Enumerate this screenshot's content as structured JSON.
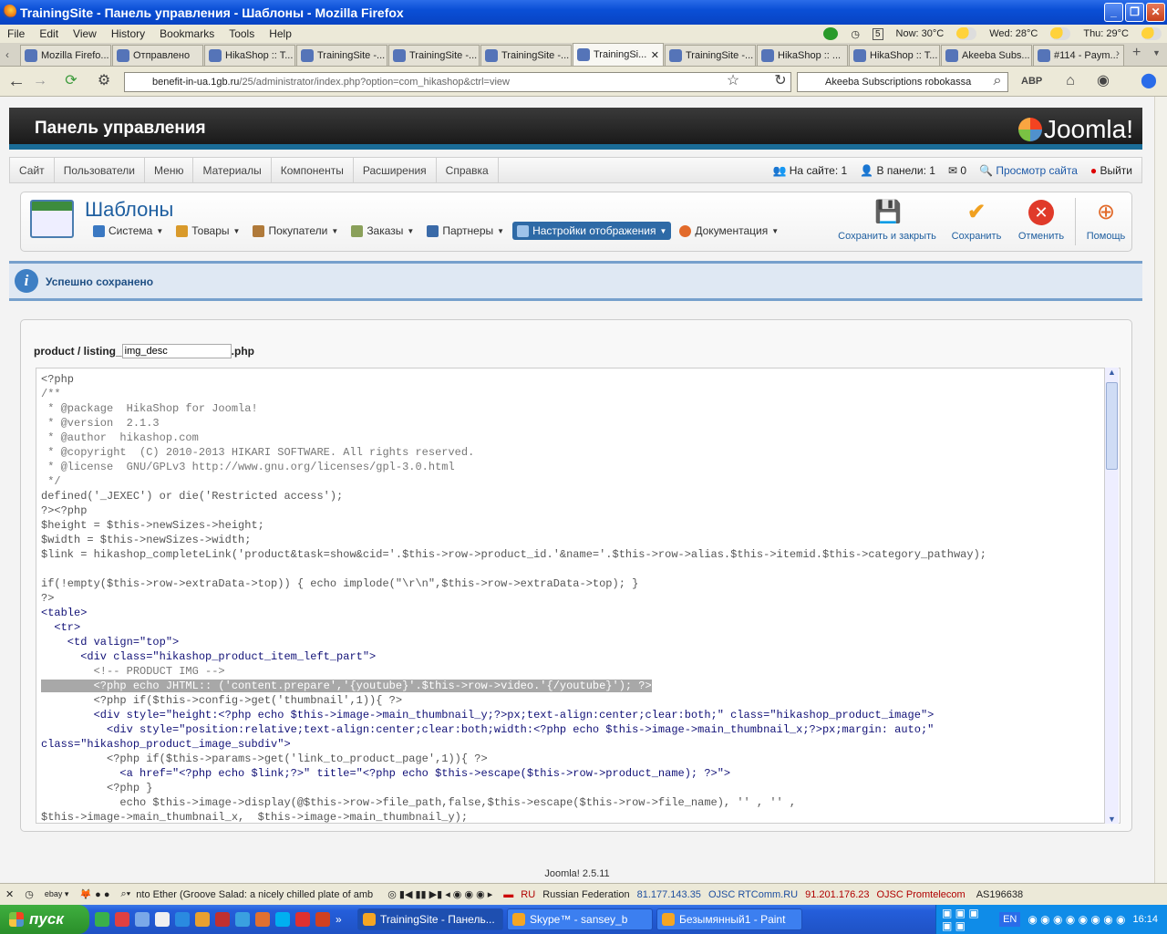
{
  "window": {
    "title": "TrainingSite - Панель управления - Шаблоны - Mozilla Firefox"
  },
  "menu": [
    "File",
    "Edit",
    "View",
    "History",
    "Bookmarks",
    "Tools",
    "Help"
  ],
  "weather": {
    "now": "Now: 30°C",
    "wed": "Wed: 28°C",
    "thu": "Thu: 29°C",
    "badge": "5"
  },
  "tabs": [
    "Mozilla Firefo...",
    "Отправлено",
    "HikaShop :: T...",
    "TrainingSite -...",
    "TrainingSite -...",
    "TrainingSite -...",
    "TrainingSi...",
    "TrainingSite -...",
    "HikaShop :: ...",
    "HikaShop :: T...",
    "Akeeba Subs...",
    "#114 - Paym..."
  ],
  "active_tab_index": 6,
  "address": {
    "host": "benefit-in-ua.1gb.ru",
    "path": "/25/administrator/index.php?option=com_hikashop&ctrl=view"
  },
  "search": {
    "value": "Akeeba Subscriptions robokassa"
  },
  "joomla": {
    "header": "Панель управления",
    "logo": "Joomla!",
    "menu": [
      "Сайт",
      "Пользователи",
      "Меню",
      "Материалы",
      "Компоненты",
      "Расширения",
      "Справка"
    ],
    "status": {
      "on_site": "На сайте: 1",
      "in_panel": "В панели: 1",
      "messages": "0",
      "view_site": "Просмотр сайта",
      "logout": "Выйти"
    },
    "page_title": "Шаблоны",
    "submenu": [
      "Система",
      "Товары",
      "Покупатели",
      "Заказы",
      "Партнеры",
      "Настройки отображения",
      "Документация"
    ],
    "toolbar": {
      "save_close": "Сохранить и закрыть",
      "save": "Сохранить",
      "cancel": "Отменить",
      "help": "Помощь"
    },
    "message": "Успешно сохранено",
    "file": {
      "prefix": "product / listing_",
      "value": "img_desc",
      "suffix": ".php"
    },
    "footer": "Joomla! 2.5.11"
  },
  "code_lines": [
    "<?php",
    "/**",
    " * @package  HikaShop for Joomla!",
    " * @version  2.1.3",
    " * @author  hikashop.com",
    " * @copyright  (C) 2010-2013 HIKARI SOFTWARE. All rights reserved.",
    " * @license  GNU/GPLv3 http://www.gnu.org/licenses/gpl-3.0.html",
    " */",
    "defined('_JEXEC') or die('Restricted access');",
    "?><?php",
    "$height = $this->newSizes->height;",
    "$width = $this->newSizes->width;",
    "$link = hikashop_completeLink('product&task=show&cid='.$this->row->product_id.'&name='.$this->row->alias.$this->itemid.$this->category_pathway);",
    "",
    "if(!empty($this->row->extraData->top)) { echo implode(\"\\r\\n\",$this->row->extraData->top); }",
    "?>",
    "<table>",
    "  <tr>",
    "    <td valign=\"top\">",
    "      <div class=\"hikashop_product_item_left_part\">",
    "        <!-- PRODUCT IMG -->",
    "        <?php echo JHTML:: ('content.prepare','{youtube}'.$this->row->video.'{/youtube}'); ?>",
    "        <?php if($this->config->get('thumbnail',1)){ ?>",
    "        <div style=\"height:<?php echo $this->image->main_thumbnail_y;?>px;text-align:center;clear:both;\" class=\"hikashop_product_image\">",
    "          <div style=\"position:relative;text-align:center;clear:both;width:<?php echo $this->image->main_thumbnail_x;?>px;margin: auto;\"",
    "class=\"hikashop_product_image_subdiv\">",
    "          <?php if($this->params->get('link_to_product_page',1)){ ?>",
    "            <a href=\"<?php echo $link;?>\" title=\"<?php echo $this->escape($this->row->product_name); ?>\">",
    "          <?php }",
    "            echo $this->image->display(@$this->row->file_path,false,$this->escape($this->row->file_name), '' , '' ,",
    "$this->image->main_thumbnail_x,  $this->image->main_thumbnail_y);"
  ],
  "addon_bar": {
    "radio": "nto Ether (Groove Salad: a nicely chilled plate of amb",
    "lang": "RU",
    "country": "Russian Federation",
    "ip1": "81.177.143.35",
    "isp1": "OJSC RTComm.RU",
    "ip2": "91.201.176.23",
    "isp2": "OJSC Promtelecom",
    "asn": "AS196638"
  },
  "taskbar": {
    "start": "пуск",
    "tasks": [
      "TrainingSite - Панель...",
      "Skype™ - sansey_b",
      "Безымянный1 - Paint"
    ],
    "lang": "EN",
    "clock": "16:14"
  }
}
